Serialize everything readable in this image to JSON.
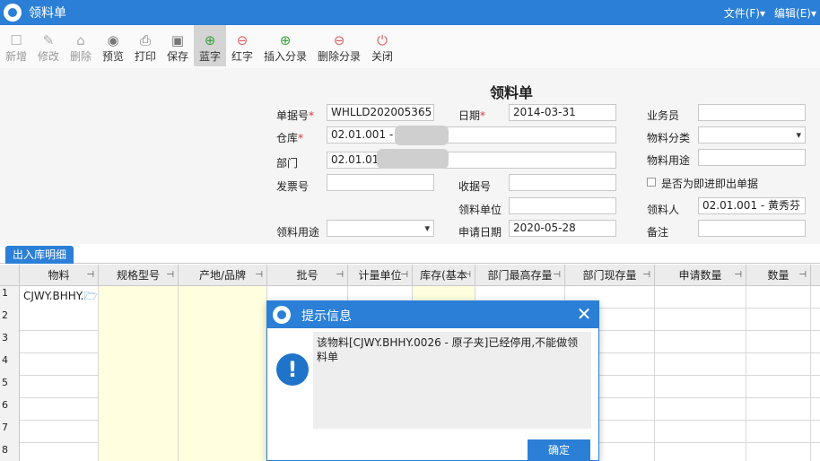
{
  "app": {
    "title": "领料单",
    "menu_file": "文件(F)▾",
    "menu_edit": "编辑(E)▾"
  },
  "toolbar": {
    "new": "新增",
    "modify": "修改",
    "delete": "删除",
    "preview": "预览",
    "print": "打印",
    "save": "保存",
    "blue": "蓝字",
    "red": "红字",
    "insert_entry": "插入分录",
    "delete_entry": "删除分录",
    "close": "关闭"
  },
  "form": {
    "title": "领料单",
    "doc_no_label": "单据号",
    "doc_no": "WHLLD202005365",
    "date_label": "日期",
    "date": "2014-03-31",
    "salesman_label": "业务员",
    "salesman": "",
    "warehouse_label": "仓库",
    "warehouse": "02.01.001 -",
    "material_category_label": "物料分类",
    "material_category": "",
    "dept_label": "部门",
    "dept": "02.01.01",
    "material_use_label": "物料用途",
    "material_use": "",
    "invoice_label": "发票号",
    "invoice": "",
    "receipt_label": "收据号",
    "receipt": "",
    "outbound_check_label": "是否为即进即出单据",
    "receiving_unit_label": "领料单位",
    "receiving_unit": "",
    "receiver_label": "领料人",
    "receiver": "02.01.001 - 黄秀芬",
    "purpose_label": "领料用途",
    "purpose": "",
    "apply_date_label": "申请日期",
    "apply_date": "2020-05-28",
    "remark_label": "备注",
    "remark": ""
  },
  "tabs": {
    "detail": "出入库明细"
  },
  "grid": {
    "columns": [
      "物料",
      "规格型号",
      "产地/品牌",
      "批号",
      "计量单位",
      "库存(基本",
      "部门最高存量",
      "部门现存量",
      "申请数量",
      "数量"
    ],
    "row1_material": "CJWY.BHHY.",
    "row_numbers": [
      "1",
      "2",
      "3",
      "4",
      "5",
      "6",
      "7",
      "8"
    ]
  },
  "dialog": {
    "title": "提示信息",
    "message": "该物料[CJWY.BHHY.0026  - 原子夹]已经停用,不能做领料单",
    "ok": "确定"
  },
  "colors": {
    "accent": "#2b7fd6",
    "required": "#dd3333",
    "yellow_cell": "#ffffe0"
  }
}
